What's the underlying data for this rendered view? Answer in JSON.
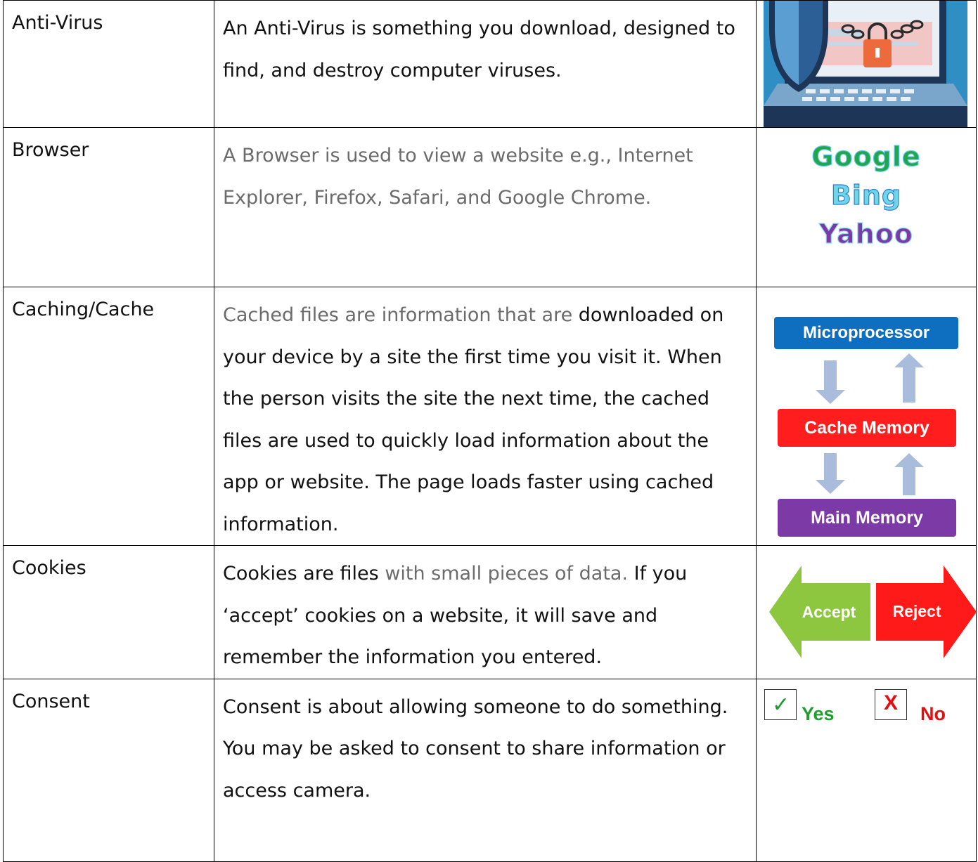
{
  "rows": [
    {
      "term": "Anti-Virus",
      "definition_parts": [
        {
          "text": "An Anti-Virus is something you download, designed to find, and destroy computer viruses.",
          "tone": "dark"
        }
      ],
      "image": {
        "icons": [
          "shield-icon",
          "laptop-icon",
          "padlock-icon",
          "chain-icon"
        ]
      }
    },
    {
      "term": "Browser",
      "definition_parts": [
        {
          "text": "A Browser is used to view a website e.g., Internet Explorer, Firefox, Safari, and Google Chrome.",
          "tone": "grey"
        }
      ],
      "image": {
        "engines": [
          "Google",
          "Bing",
          "Yahoo"
        ]
      }
    },
    {
      "term": "Caching/Cache",
      "definition_parts": [
        {
          "text": "Cached files are information that are ",
          "tone": "grey"
        },
        {
          "text": "downloaded on your device by a site the first time you visit it. When the person visits the site the next time, the cached files are used to quickly load information about the app or website. The page loads faster using cached information.",
          "tone": "dark"
        }
      ],
      "image": {
        "boxes": [
          "Microprocessor",
          "Cache Memory",
          "Main Memory"
        ],
        "colors": [
          "#0e6fc1",
          "#ff1d1d",
          "#7c3aa6"
        ]
      }
    },
    {
      "term": "Cookies",
      "definition_parts": [
        {
          "text": "Cookies are files ",
          "tone": "dark"
        },
        {
          "text": "with small pieces of data. ",
          "tone": "grey"
        },
        {
          "text": "If you ‘accept’ cookies on a website, it will save and remember the information you entered.",
          "tone": "dark"
        }
      ],
      "image": {
        "accept": "Accept",
        "reject": "Reject",
        "accept_color": "#8dc63f",
        "reject_color": "#ff1a1a"
      }
    },
    {
      "term": "Consent",
      "definition_parts": [
        {
          "text": "Consent is about allowing someone to do something. You may be asked to consent to share information or access camera.",
          "tone": "dark"
        }
      ],
      "image": {
        "yes": "Yes",
        "no": "No",
        "x": "X",
        "tick": "✓"
      }
    }
  ]
}
